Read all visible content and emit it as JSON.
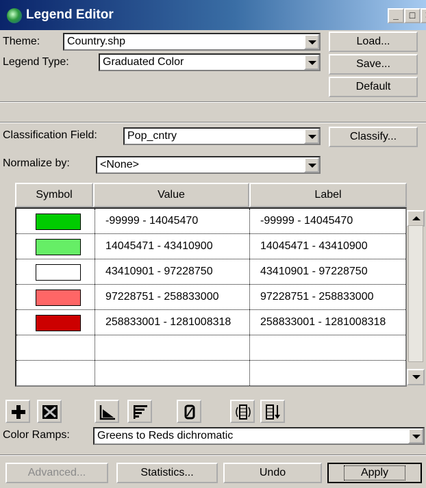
{
  "window": {
    "title": "Legend Editor"
  },
  "theme": {
    "label": "Theme:",
    "value": "Country.shp"
  },
  "legend_type": {
    "label": "Legend Type:",
    "value": "Graduated Color"
  },
  "buttons": {
    "load": "Load...",
    "save": "Save...",
    "default": "Default",
    "classify": "Classify..."
  },
  "classification_field": {
    "label": "Classification Field:",
    "value": "Pop_cntry"
  },
  "normalize_by": {
    "label": "Normalize by:",
    "value": "<None>"
  },
  "table": {
    "columns": [
      "Symbol",
      "Value",
      "Label"
    ],
    "rows": [
      {
        "color": "#00cc00",
        "value": "-99999 - 14045470",
        "label": "-99999 - 14045470"
      },
      {
        "color": "#66ee66",
        "value": "14045471 - 43410900",
        "label": "14045471 - 43410900"
      },
      {
        "color": "#ffffff",
        "value": "43410901 - 97228750",
        "label": "43410901 - 97228750"
      },
      {
        "color": "#ff6666",
        "value": "97228751 - 258833000",
        "label": "97228751 - 258833000"
      },
      {
        "color": "#cc0000",
        "value": "258833001 - 1281008318",
        "label": "258833001 - 1281008318"
      }
    ]
  },
  "color_ramps": {
    "label": "Color Ramps:",
    "value": "Greens to Reds dichromatic"
  },
  "footer": {
    "advanced": "Advanced...",
    "statistics": "Statistics...",
    "undo": "Undo",
    "apply": "Apply"
  },
  "tools": [
    "add-icon",
    "delete-icon",
    "sort-ascending-icon",
    "sort-descending-icon",
    "null-value-icon",
    "flip-symbols-icon",
    "reverse-order-icon"
  ]
}
